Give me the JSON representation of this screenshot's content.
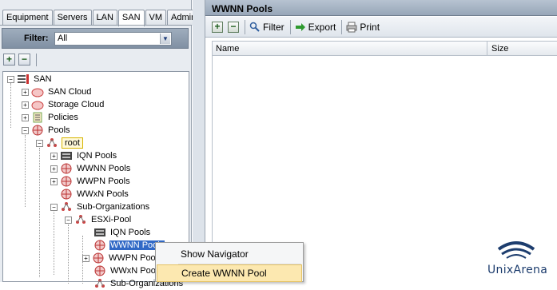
{
  "navigator": {
    "tabs": [
      "Equipment",
      "Servers",
      "LAN",
      "SAN",
      "VM",
      "Admin"
    ],
    "active_tab": "SAN",
    "filter": {
      "label": "Filter:",
      "value": "All"
    },
    "tree": {
      "root": "SAN",
      "san_cloud": "SAN Cloud",
      "storage_cloud": "Storage Cloud",
      "policies": "Policies",
      "pools": "Pools",
      "org_root": "root",
      "iqn_pools": "IQN Pools",
      "wwnn_pools": "WWNN Pools",
      "wwpn_pools": "WWPN Pools",
      "wwxn_pools": "WWxN Pools",
      "sub_orgs": "Sub-Organizations",
      "esxi_pool": "ESXi-Pool",
      "esxi_iqn": "IQN Pools",
      "esxi_wwnn": "WWNN Pools",
      "esxi_wwpn": "WWPN Pools",
      "esxi_wwxn": "WWxN Pools",
      "esxi_sub": "Sub-Organizations"
    }
  },
  "content": {
    "title": "WWNN Pools",
    "toolbar": {
      "filter": "Filter",
      "export": "Export",
      "print": "Print"
    },
    "columns": [
      "Name",
      "Size"
    ]
  },
  "context_menu": {
    "items": [
      "Show Navigator",
      "Create WWNN Pool"
    ],
    "highlighted": "Create WWNN Pool"
  },
  "watermark": {
    "text": "UnixArena"
  },
  "colors": {
    "selection": "#3169c6",
    "menu_highlight": "#fce8b0",
    "header_blue": "#97a6b8"
  }
}
